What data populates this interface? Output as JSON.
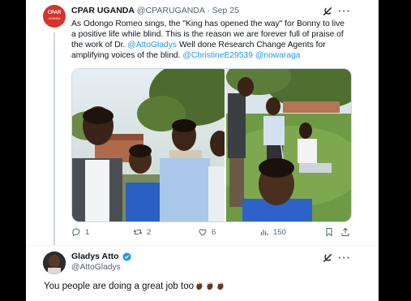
{
  "tweet": {
    "avatar_text": "CPAR",
    "avatar_subtext": "UGANDA",
    "author_name": "CPAR UGANDA",
    "handle": "@CPARUGANDA",
    "separator": "·",
    "date": "Sep 25",
    "text_part1": "As Odongo Romeo sings, the \"King has opened the way\" for Bonny to live a positive life while blind. This is the reason we are forever full of praise of the work of Dr. ",
    "mention1": "@AttoGladys",
    "text_part2": " Well done Research Change Agents for amplifying voices of the blind. ",
    "mention2": "@ChristineE29539",
    "mention3": "@nowaraga",
    "actions": {
      "replies": "1",
      "retweets": "2",
      "likes": "6",
      "views": "150"
    }
  },
  "reply": {
    "author_name": "Gladys Atto",
    "handle": "@AttoGladys",
    "text": "You people are doing a great job too",
    "emoji_count": 3
  },
  "colors": {
    "link": "#1d9bf0",
    "verified": "#1d9bf0",
    "muted": "#536471",
    "avatar_bg": "#d7332a"
  },
  "icons": [
    "grok-icon",
    "more-icon",
    "reply-icon",
    "retweet-icon",
    "like-icon",
    "views-icon",
    "bookmark-icon",
    "share-icon",
    "verified-badge-icon",
    "clap-icon"
  ]
}
